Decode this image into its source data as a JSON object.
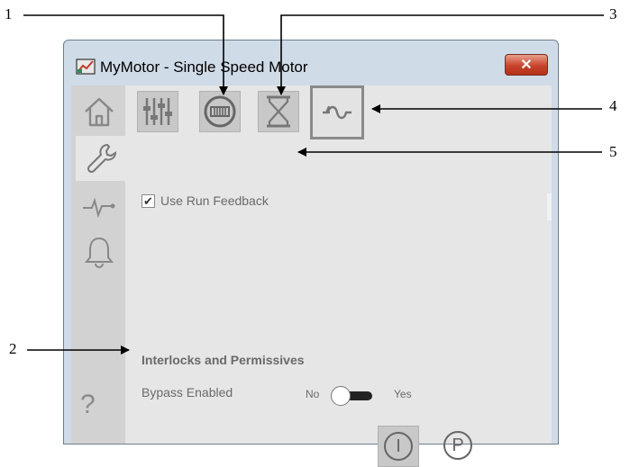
{
  "window": {
    "title": "MyMotor - Single Speed Motor",
    "close_icon": "close-icon"
  },
  "sidebar": {
    "items": [
      {
        "name": "home",
        "icon": "home-icon"
      },
      {
        "name": "maintenance",
        "icon": "wrench-icon",
        "active": true
      },
      {
        "name": "trends",
        "icon": "trend-icon"
      },
      {
        "name": "alarms",
        "icon": "bell-icon"
      }
    ],
    "help_label": "?"
  },
  "toolbar": {
    "buttons": [
      {
        "name": "settings",
        "icon": "sliders-icon"
      },
      {
        "name": "run-feedback",
        "icon": "motor-status-icon"
      },
      {
        "name": "timers",
        "icon": "hourglass-icon"
      },
      {
        "name": "feedback-options",
        "icon": "feedback-wave-icon",
        "selected": true
      }
    ]
  },
  "options": {
    "use_run_feedback_label": "Use Run Feedback",
    "use_run_feedback_checked": true
  },
  "interlocks": {
    "heading": "Interlocks and Permissives",
    "bypass_label": "Bypass Enabled",
    "toggle_off_label": "No",
    "toggle_on_label": "Yes"
  },
  "bottom_buttons": {
    "interlock_label": "I",
    "permissive_label": "P"
  },
  "callouts": [
    "1",
    "2",
    "3",
    "4",
    "5"
  ],
  "colors": {
    "window_frame": "#cfdbe6",
    "client_bg": "#e6e6e6",
    "sidebar_bg": "#d2d2d2",
    "close_button": "#c8432b",
    "label_text": "#6a6a6a"
  }
}
